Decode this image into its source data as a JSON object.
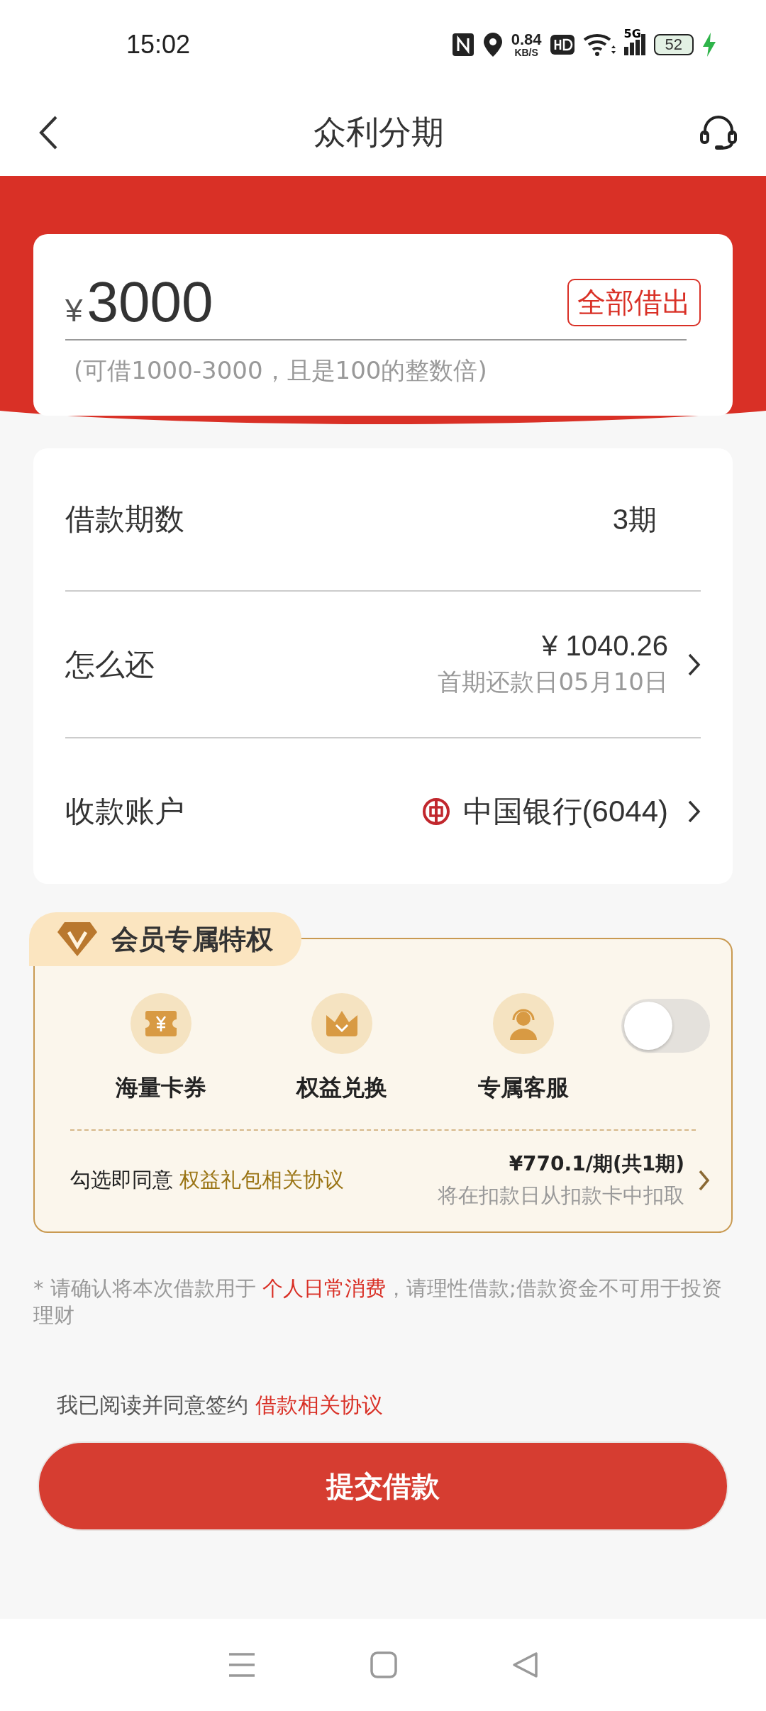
{
  "status_bar": {
    "time": "15:02",
    "net_speed": "0.84",
    "net_unit": "KB/S",
    "network": "5G",
    "battery": "52"
  },
  "header": {
    "title": "众利分期"
  },
  "amount": {
    "currency": "¥",
    "value": "3000",
    "all_button": "全部借出",
    "hint": "(可借1000-3000，且是100的整数倍)"
  },
  "rows": [
    {
      "kind": "plain",
      "label": "借款期数",
      "value": "3期"
    },
    {
      "kind": "repay",
      "label": "怎么还",
      "value": "¥ 1040.26",
      "sub": "首期还款日05月10日"
    },
    {
      "kind": "bank",
      "label": "收款账户",
      "value": "中国银行(6044)"
    }
  ],
  "member": {
    "title": "会员专属特权",
    "on": false,
    "benefits": [
      {
        "kind": "coupon",
        "label": "海量卡券"
      },
      {
        "kind": "crown",
        "label": "权益兑换"
      },
      {
        "kind": "service",
        "label": "专属客服"
      }
    ],
    "agree_text": "勾选即同意",
    "agree_link": "权益礼包相关协议",
    "price": "¥770.1/期(共1期)",
    "price_note": "将在扣款日从扣款卡中扣取"
  },
  "disclaimer": {
    "before": "* 请确认将本次借款用于 ",
    "highlight": "个人日常消费",
    "after": "，请理性借款;借款资金不可用于投资理财"
  },
  "consent": {
    "text": "我已阅读并同意签约",
    "link": "借款相关协议"
  },
  "submit": "提交借款"
}
